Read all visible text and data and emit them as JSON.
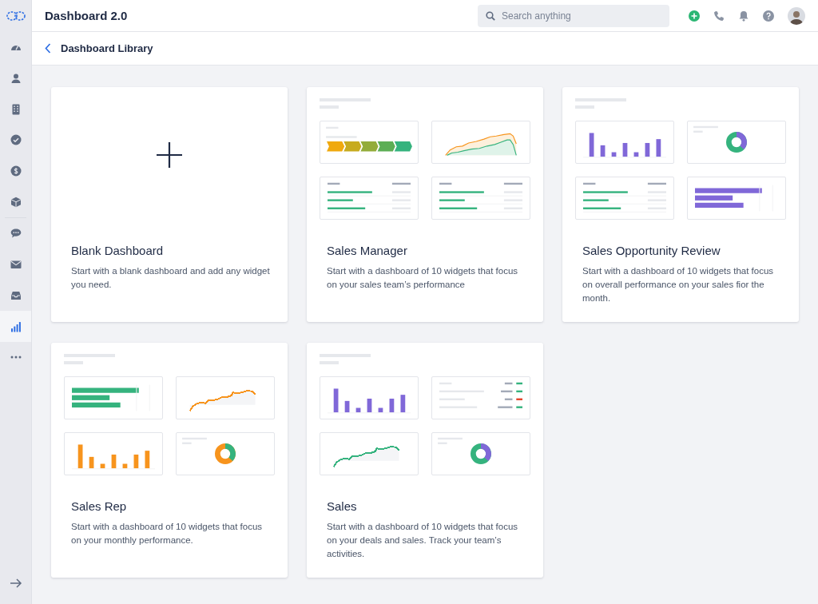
{
  "sidebar": {
    "items": [
      {
        "kind": "dashboard",
        "selected": false
      },
      {
        "kind": "contacts",
        "selected": false
      },
      {
        "kind": "companies",
        "selected": false
      },
      {
        "kind": "tasks",
        "selected": false
      },
      {
        "kind": "deals",
        "selected": false
      },
      {
        "kind": "products",
        "selected": false
      },
      {
        "kind": "chat",
        "selected": false
      },
      {
        "kind": "mail",
        "selected": false
      },
      {
        "kind": "inbox",
        "selected": false
      },
      {
        "kind": "reports",
        "selected": true
      },
      {
        "kind": "more",
        "selected": false
      }
    ]
  },
  "top_bar": {
    "title": "Dashboard 2.0",
    "search": {
      "placeholder": "Search anything"
    }
  },
  "sub_header": {
    "title": "Dashboard Library"
  },
  "cards": [
    {
      "kind": "blank",
      "title": "Blank Dashboard",
      "description": "Start with a blank dashboard and add any widget you need."
    },
    {
      "kind": "template",
      "title": "Sales Manager",
      "description": "Start with a dashboard of 10 widgets that focus on your sales team’s performance",
      "widgets": [
        {
          "kind": "funnel"
        },
        {
          "kind": "area"
        },
        {
          "kind": "table"
        },
        {
          "kind": "table"
        }
      ]
    },
    {
      "kind": "template",
      "title": "Sales Opportunity Review",
      "description": "Start with a dashboard of 10 widgets that focus on overall performance on your sales fior the month.",
      "widgets": [
        {
          "kind": "bars",
          "color": "#8068d8"
        },
        {
          "kind": "donut",
          "color": "#35b37e"
        },
        {
          "kind": "table"
        },
        {
          "kind": "hbars",
          "color": "#8068d8"
        }
      ]
    },
    {
      "kind": "template",
      "title": "Sales Rep",
      "description": "Start with a dashboard of 10 widgets that focus on your monthly performance.",
      "widgets": [
        {
          "kind": "hbars",
          "color": "#35b37e"
        },
        {
          "kind": "line",
          "color": "#f7941d"
        },
        {
          "kind": "bars",
          "color": "#f7941d"
        },
        {
          "kind": "donut",
          "color": "#f7941d"
        }
      ]
    },
    {
      "kind": "template",
      "title": "Sales",
      "description": "Start with a dashboard of 10 widgets that focus on your deals and sales. Track your team’s activities.",
      "widgets": [
        {
          "kind": "bars",
          "color": "#8068d8"
        },
        {
          "kind": "status"
        },
        {
          "kind": "line",
          "color": "#35b37e"
        },
        {
          "kind": "donut",
          "color": "#35b37e"
        }
      ]
    }
  ]
}
